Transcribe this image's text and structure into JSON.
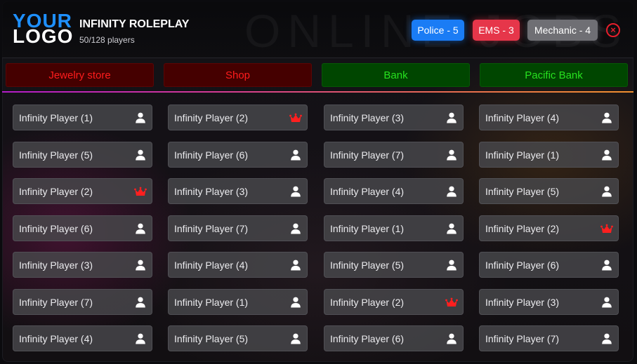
{
  "header": {
    "logo_line1": "YOUR",
    "logo_line2": "LOGO",
    "server_name": "INFINITY ROLEPLAY",
    "player_count": "50/128 players",
    "watermark": "ONLINE JOBS"
  },
  "badges": [
    {
      "label": "Police - 5",
      "color": "#1a7cf5"
    },
    {
      "label": "EMS - 3",
      "color": "#e6364a"
    },
    {
      "label": "Mechanic - 4",
      "color": "#6f6f74"
    }
  ],
  "close_symbol": "×",
  "jobs": [
    {
      "label": "Jewelry store",
      "status": "closed"
    },
    {
      "label": "Shop",
      "status": "closed"
    },
    {
      "label": "Bank",
      "status": "open"
    },
    {
      "label": "Pacific Bank",
      "status": "open"
    }
  ],
  "icons": {
    "player": "user-icon",
    "admin": "crown-icon"
  },
  "players": [
    [
      {
        "name": "Infinity Player (1)",
        "icon": "user"
      },
      {
        "name": "Infinity Player (2)",
        "icon": "crown"
      },
      {
        "name": "Infinity Player (3)",
        "icon": "user"
      },
      {
        "name": "Infinity Player (4)",
        "icon": "user"
      }
    ],
    [
      {
        "name": "Infinity Player (5)",
        "icon": "user"
      },
      {
        "name": "Infinity Player (6)",
        "icon": "user"
      },
      {
        "name": "Infinity Player (7)",
        "icon": "user"
      },
      {
        "name": "Infinity Player (1)",
        "icon": "user"
      }
    ],
    [
      {
        "name": "Infinity Player (2)",
        "icon": "crown"
      },
      {
        "name": "Infinity Player (3)",
        "icon": "user"
      },
      {
        "name": "Infinity Player (4)",
        "icon": "user"
      },
      {
        "name": "Infinity Player (5)",
        "icon": "user"
      }
    ],
    [
      {
        "name": "Infinity Player (6)",
        "icon": "user"
      },
      {
        "name": "Infinity Player (7)",
        "icon": "user"
      },
      {
        "name": "Infinity Player (1)",
        "icon": "user"
      },
      {
        "name": "Infinity Player (2)",
        "icon": "crown"
      }
    ],
    [
      {
        "name": "Infinity Player (3)",
        "icon": "user"
      },
      {
        "name": "Infinity Player (4)",
        "icon": "user"
      },
      {
        "name": "Infinity Player (5)",
        "icon": "user"
      },
      {
        "name": "Infinity Player (6)",
        "icon": "user"
      }
    ],
    [
      {
        "name": "Infinity Player (7)",
        "icon": "user"
      },
      {
        "name": "Infinity Player (1)",
        "icon": "user"
      },
      {
        "name": "Infinity Player (2)",
        "icon": "crown"
      },
      {
        "name": "Infinity Player (3)",
        "icon": "user"
      }
    ],
    [
      {
        "name": "Infinity Player (4)",
        "icon": "user"
      },
      {
        "name": "Infinity Player (5)",
        "icon": "user"
      },
      {
        "name": "Infinity Player (6)",
        "icon": "user"
      },
      {
        "name": "Infinity Player (7)",
        "icon": "user"
      }
    ]
  ]
}
